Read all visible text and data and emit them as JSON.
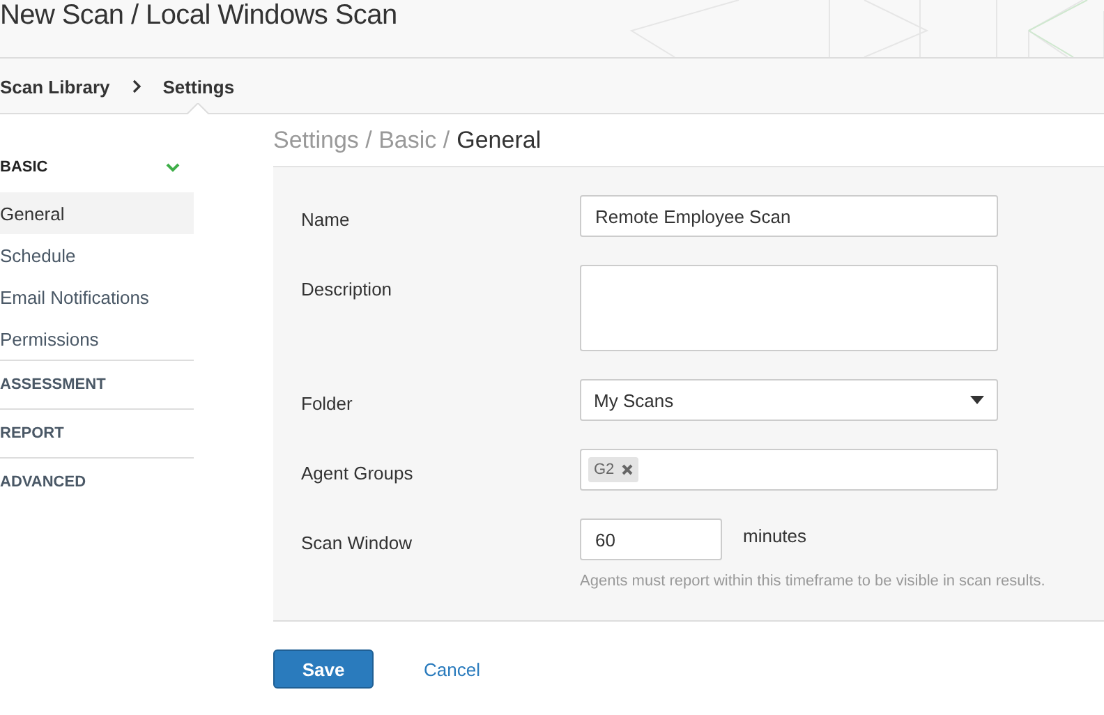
{
  "page_title": "New Scan / Local Windows Scan",
  "breadcrumb": [
    {
      "label": "Scan Library",
      "selected": false
    },
    {
      "label": "Settings",
      "selected": true
    }
  ],
  "sidebar": {
    "sections": [
      {
        "label": "BASIC",
        "expanded": true,
        "items": [
          {
            "label": "General",
            "selected": true
          },
          {
            "label": "Schedule",
            "selected": false
          },
          {
            "label": "Email Notifications",
            "selected": false
          },
          {
            "label": "Permissions",
            "selected": false
          }
        ]
      },
      {
        "label": "ASSESSMENT",
        "expanded": false
      },
      {
        "label": "REPORT",
        "expanded": false
      },
      {
        "label": "ADVANCED",
        "expanded": false
      }
    ]
  },
  "section_path": {
    "parents": "Settings / Basic /",
    "current": "General"
  },
  "form": {
    "fields": [
      {
        "kind": "text",
        "label": "Name",
        "value": "Remote Employee Scan"
      },
      {
        "kind": "textarea",
        "label": "Description"
      },
      {
        "kind": "select",
        "label": "Folder",
        "value": "My Scans"
      },
      {
        "kind": "tags",
        "label": "Agent Groups",
        "tags": [
          "G2"
        ]
      },
      {
        "kind": "number",
        "label": "Scan Window",
        "value": "60",
        "unit": "minutes",
        "help": "Agents must report within this timeframe to be visible in scan results."
      }
    ]
  },
  "buttons": {
    "save": "Save",
    "cancel": "Cancel"
  }
}
